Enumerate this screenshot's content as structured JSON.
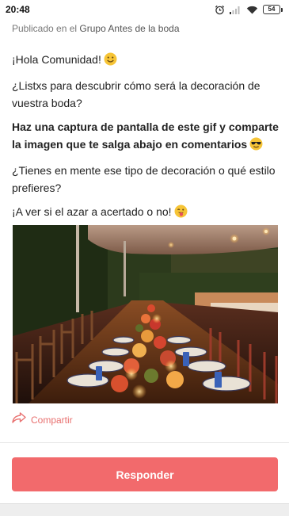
{
  "status_bar": {
    "time": "20:48",
    "battery": "54"
  },
  "post": {
    "published_prefix": "Publicado en el",
    "group_name": "Grupo Antes de la boda",
    "paragraphs": [
      "¡Hola Comunidad!",
      "¿Listxs para descubrir cómo será la decoración de vuestra boda?",
      "Haz una captura de pantalla de este gif y comparte la imagen que te salga abajo en comentarios",
      "¿Tienes en mente ese tipo de decoración o qué estilo prefieres?",
      "¡A ver si el azar a acertado o no!"
    ],
    "emoji_icons": [
      "smiling-face-icon",
      "sunglasses-face-icon",
      "tongue-wink-face-icon"
    ],
    "image_icon": "wedding-table-decoration-photo"
  },
  "actions": {
    "share_label": "Compartir",
    "reply_label": "Responder"
  },
  "colors": {
    "accent": "#f26a6c",
    "share_text": "#e8706f",
    "emoji": "#f6c436"
  }
}
